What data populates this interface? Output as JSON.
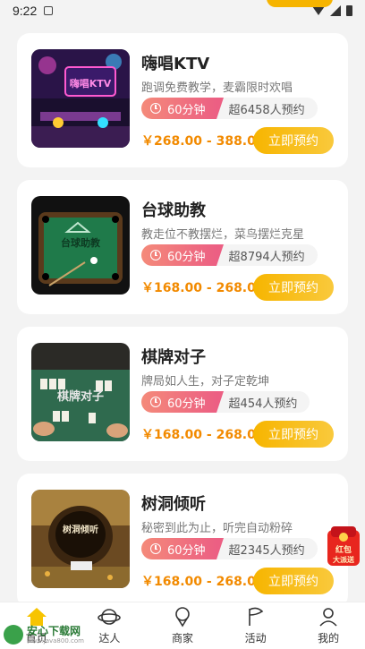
{
  "status": {
    "time": "9:22"
  },
  "cards": [
    {
      "title": "嗨唱KTV",
      "desc": "跑调免费教学，麦霸限时欢唱",
      "duration": "60分钟",
      "booked": "超6458人预约",
      "price": "￥268.00 - 388.00",
      "button": "立即预约",
      "thumb_label": "嗨唱KTV"
    },
    {
      "title": "台球助教",
      "desc": "教走位不教摆烂，菜鸟摆烂克星",
      "duration": "60分钟",
      "booked": "超8794人预约",
      "price": "￥168.00 - 268.00",
      "button": "立即预约",
      "thumb_label": "台球助教"
    },
    {
      "title": "棋牌对子",
      "desc": "牌局如人生，对子定乾坤",
      "duration": "60分钟",
      "booked": "超454人预约",
      "price": "￥168.00 - 268.00",
      "button": "立即预约",
      "thumb_label": "棋牌对子"
    },
    {
      "title": "树洞倾听",
      "desc": "秘密到此为止，听完自动粉碎",
      "duration": "60分钟",
      "booked": "超2345人预约",
      "price": "￥168.00 - 268.00",
      "button": "立即预约",
      "thumb_label": "树洞倾听"
    }
  ],
  "float_badge": {
    "line1": "红包",
    "line2": "大派送"
  },
  "tabs": [
    {
      "label": "首页",
      "icon": "home-icon"
    },
    {
      "label": "达人",
      "icon": "planet-icon"
    },
    {
      "label": "商家",
      "icon": "shop-pin-icon"
    },
    {
      "label": "活动",
      "icon": "flag-icon"
    },
    {
      "label": "我的",
      "icon": "profile-icon"
    }
  ],
  "watermark": {
    "line1": "安心下载网",
    "line2": "www.java800.com"
  },
  "colors": {
    "accent": "#f7b500",
    "price": "#f28a00",
    "duration_badge": "#ec5f83"
  }
}
